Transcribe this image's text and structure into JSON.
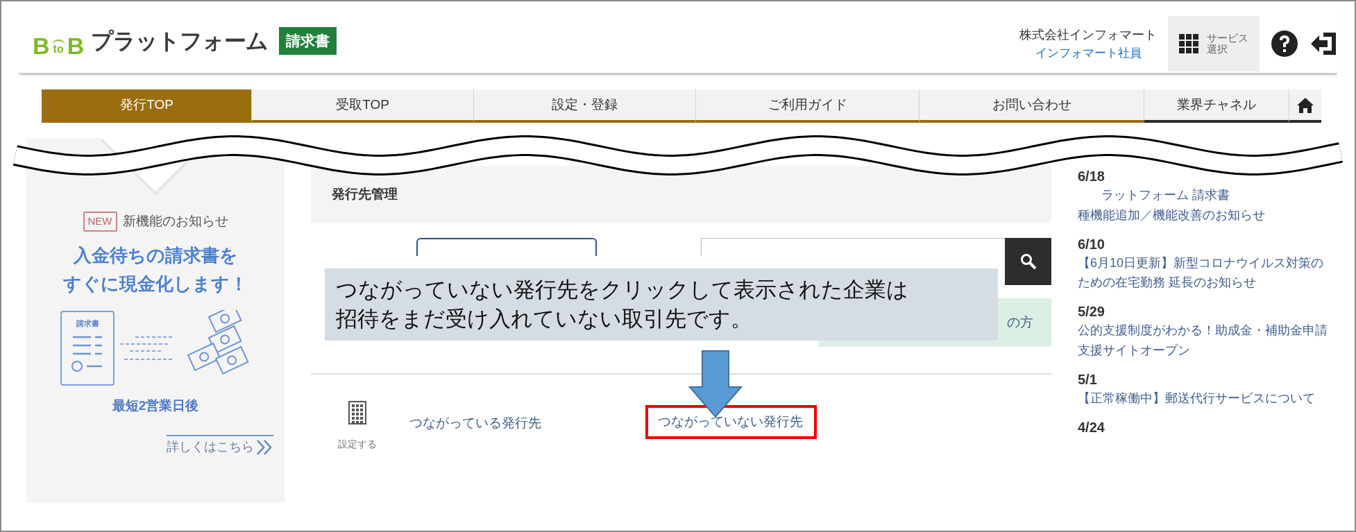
{
  "header": {
    "logo": {
      "letter_left": "B",
      "small": "to",
      "letter_right": "B",
      "name": "プラットフォーム"
    },
    "product_badge": "請求書",
    "company": "株式会社インフォマート",
    "user": "インフォマート社員",
    "service_button": {
      "line1": "サービス",
      "line2": "選択"
    }
  },
  "nav_tabs": [
    {
      "kind": "text",
      "label": "発行TOP",
      "selected": true
    },
    {
      "kind": "text",
      "label": "受取TOP",
      "selected": false
    },
    {
      "kind": "text",
      "label": "設定・登録",
      "selected": false
    },
    {
      "kind": "text",
      "label": "ご利用ガイド",
      "selected": false
    },
    {
      "kind": "text",
      "label": "お問い合わせ",
      "selected": false
    },
    {
      "kind": "channel",
      "label": "業界チャネル",
      "selected": false
    },
    {
      "kind": "home",
      "selected": false
    }
  ],
  "banner": {
    "new_badge": "NEW",
    "heading": "新機能のお知らせ",
    "headline_lines": [
      "入金待ちの請求書を",
      "すぐに現金化します！"
    ],
    "document_label": "請求書",
    "caption": "最短2営業日後",
    "link": "詳しくはこちら"
  },
  "main": {
    "title": "発行先管理",
    "notice_fragment": "の方",
    "icon_caption": "設定する",
    "connected_link": "つながっている発行先",
    "unconnected_link": {
      "label": "つながっていない発行先",
      "highlighted": true
    }
  },
  "callout": {
    "lines": [
      "つながっていない発行先をクリックして表示された企業は",
      "招待をまだ受け入れていない取引先です。"
    ]
  },
  "news": [
    {
      "date": "6/18",
      "partial_line": "ラットフォーム 請求書",
      "text": "種機能追加／機能改善のお知らせ"
    },
    {
      "date": "6/10",
      "text": "【6月10日更新】新型コロナウイルス対策のための在宅勤務 延長のお知らせ"
    },
    {
      "date": "5/29",
      "text": "公的支援制度がわかる！助成金・補助金申請支援サイトオープン"
    },
    {
      "date": "5/1",
      "text": "【正常稼働中】郵送代行サービスについて"
    },
    {
      "date": "4/24"
    }
  ]
}
